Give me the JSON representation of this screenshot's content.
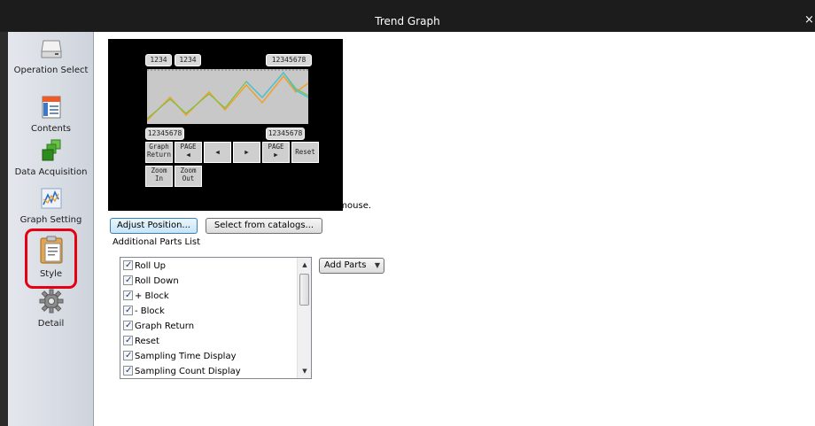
{
  "window": {
    "title": "Trend Graph",
    "close_glyph": "×"
  },
  "sidebar": {
    "items": [
      {
        "label": "Operation Select",
        "icon": "drive-icon"
      },
      {
        "label": "Contents",
        "icon": "document-icon"
      },
      {
        "label": "Data Acquisition",
        "icon": "stacked-blocks-icon"
      },
      {
        "label": "Graph Setting",
        "icon": "line-graph-icon"
      },
      {
        "label": "Style",
        "icon": "clipboard-icon",
        "selected": true
      },
      {
        "label": "Detail",
        "icon": "gear-icon"
      }
    ],
    "highlight_color": "#e60012"
  },
  "preview": {
    "top_labels": [
      "1234",
      "1234",
      "12345678"
    ],
    "bottom_labels": [
      "12345678",
      "12345678"
    ],
    "buttons": [
      {
        "label": "Graph\nReturn"
      },
      {
        "label": "PAGE\n◀"
      },
      {
        "label": "◀"
      },
      {
        "label": "▶"
      },
      {
        "label": "PAGE\n▶"
      },
      {
        "label": "Reset"
      },
      {
        "label": "Zoom\nIn"
      },
      {
        "label": "Zoom\nOut"
      }
    ],
    "trend_colors": [
      "#f0a02a",
      "#48c3d6",
      "#7ac143"
    ]
  },
  "main": {
    "hint": "Parts on the preview pane can be selected with the mouse.",
    "adjust_position_label": "Adjust Position...",
    "select_catalog_label": "Select from catalogs...",
    "additional_parts_label": "Additional Parts List",
    "add_parts_label": "Add Parts",
    "parts": [
      {
        "label": "Roll Up",
        "checked": true
      },
      {
        "label": "Roll Down",
        "checked": true
      },
      {
        "label": "+ Block",
        "checked": true
      },
      {
        "label": "- Block",
        "checked": true
      },
      {
        "label": "Graph Return",
        "checked": true
      },
      {
        "label": "Reset",
        "checked": true
      },
      {
        "label": "Sampling Time Display",
        "checked": true
      },
      {
        "label": "Sampling Count Display",
        "checked": true
      }
    ]
  }
}
